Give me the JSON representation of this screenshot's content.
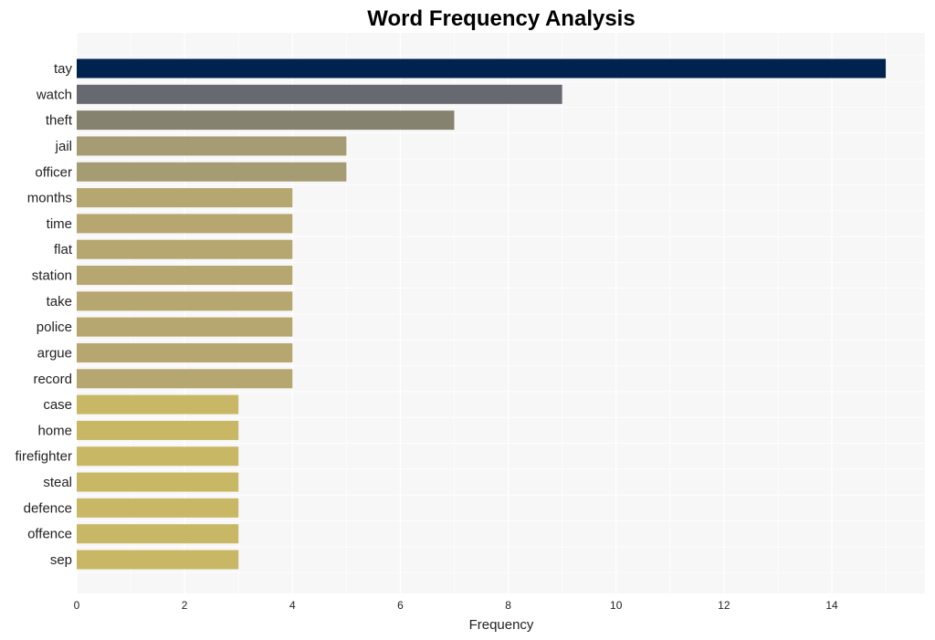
{
  "chart_data": {
    "type": "bar",
    "orientation": "horizontal",
    "title": "Word Frequency Analysis",
    "xlabel": "Frequency",
    "ylabel": "",
    "xlim": [
      0,
      15.7
    ],
    "xticks": [
      0,
      2,
      4,
      6,
      8,
      10,
      12,
      14
    ],
    "grid": true,
    "legend": "none",
    "categories": [
      "tay",
      "watch",
      "theft",
      "jail",
      "officer",
      "months",
      "time",
      "flat",
      "station",
      "take",
      "police",
      "argue",
      "record",
      "case",
      "home",
      "firefighter",
      "steal",
      "defence",
      "offence",
      "sep"
    ],
    "values": [
      15,
      9,
      7,
      5,
      5,
      4,
      4,
      4,
      4,
      4,
      4,
      4,
      4,
      3,
      3,
      3,
      3,
      3,
      3,
      3
    ],
    "colors": [
      "#00224e",
      "#666970",
      "#85826f",
      "#a59c74",
      "#a59c74",
      "#b6a66f",
      "#b6a66f",
      "#b6a66f",
      "#b6a66f",
      "#b6a66f",
      "#b6a66f",
      "#b6a66f",
      "#b6a66f",
      "#c8b866",
      "#c8b866",
      "#c8b866",
      "#c8b866",
      "#c8b866",
      "#c8b866",
      "#c8b866"
    ],
    "background_color": "#f7f7f7",
    "grid_color": "#ffffff"
  }
}
